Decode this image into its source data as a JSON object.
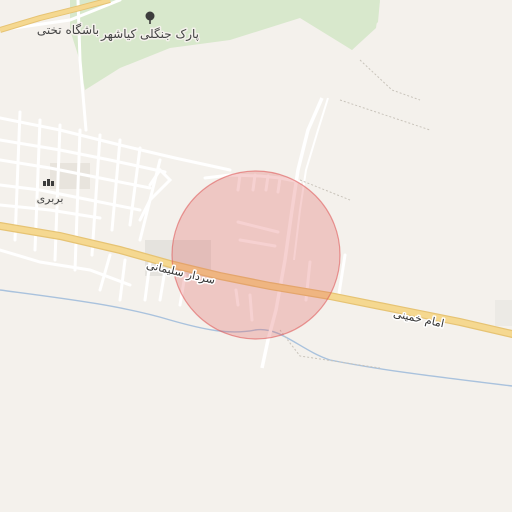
{
  "map": {
    "labels": {
      "park": "پارک جنگلی کیاشهر",
      "club": "باشگاه تختی",
      "village": "بربری",
      "road_west": "سردار سلیمانی",
      "road_east": "امام خمینی"
    },
    "icons": {
      "park": "tree-icon",
      "village": "landmark-icon"
    },
    "highlight": {
      "shape": "circle",
      "color": "#e05a5a"
    },
    "colors": {
      "background": "#f4f1ec",
      "park": "#d8e8cc",
      "main_road": "#f5d890",
      "main_road_casing": "#e6c373",
      "minor_road": "#ffffff",
      "river": "#a9c2dd"
    }
  }
}
